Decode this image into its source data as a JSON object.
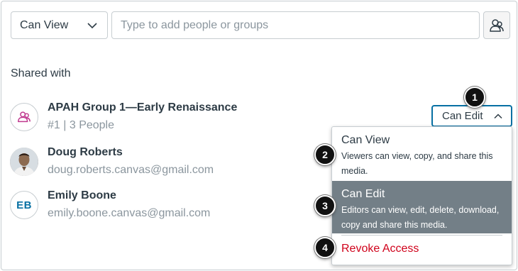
{
  "toolbar": {
    "permission_select": "Can View",
    "people_input_placeholder": "Type to add people or groups"
  },
  "section_title": "Shared with",
  "entries": [
    {
      "name": "APAH Group 1—Early Renaissance",
      "sub": "#1 | 3 People",
      "avatar_type": "group-icon"
    },
    {
      "name": "Doug Roberts",
      "sub": "doug.roberts.canvas@gmail.com",
      "avatar_type": "photo"
    },
    {
      "name": "Emily Boone",
      "sub": "emily.boone.canvas@gmail.com",
      "avatar_initials": "EB"
    }
  ],
  "role_button": {
    "label": "Can Edit"
  },
  "menu": {
    "can_view": {
      "title": "Can View",
      "desc": "Viewers can view, copy, and share this media."
    },
    "can_edit": {
      "title": "Can Edit",
      "desc": "Editors can view, edit, delete, download, copy and share this media."
    },
    "revoke": {
      "title": "Revoke Access"
    }
  },
  "markers": [
    "1",
    "2",
    "3",
    "4"
  ],
  "colors": {
    "accent_blue": "#0770a3",
    "group_icon_pink": "#c0398f",
    "selected_item_bg": "#737f87",
    "danger_red": "#d0021b",
    "text": "#2d3b45",
    "muted_text": "#8b969e"
  }
}
